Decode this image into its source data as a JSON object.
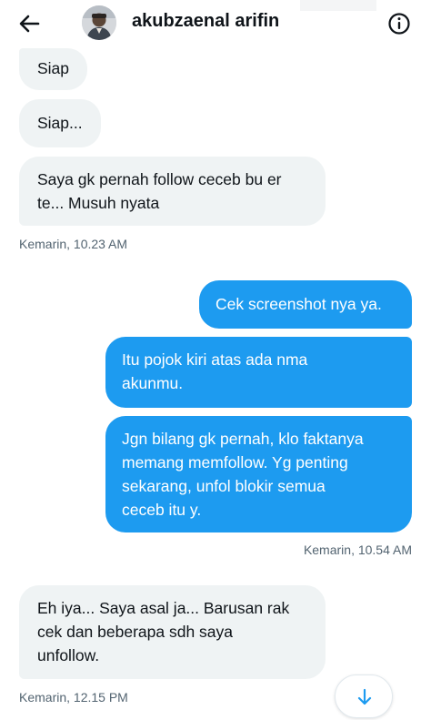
{
  "header": {
    "title": "akubzaenal arifin",
    "back_icon": "arrow-left-icon",
    "info_icon": "info-circle-icon"
  },
  "messages": [
    {
      "direction": "incoming",
      "text": "Siap"
    },
    {
      "direction": "incoming",
      "text": "Siap..."
    },
    {
      "direction": "incoming",
      "text": "Saya gk pernah follow ceceb bu er\nte... Musuh nyata"
    },
    {
      "direction": "outgoing",
      "text": "Cek screenshot nya ya."
    },
    {
      "direction": "outgoing",
      "text": "Itu pojok kiri atas ada nma\nakunmu."
    },
    {
      "direction": "outgoing",
      "text": "Jgn bilang gk pernah, klo faktanya\nmemang memfollow. Yg penting\nsekarang, unfol blokir semua\nceceb itu y."
    },
    {
      "direction": "incoming",
      "text": "Eh iya... Saya asal ja... Barusan rak\ncek dan beberapa sdh saya\nunfollow."
    }
  ],
  "timestamps": [
    "Kemarin, 10.23 AM",
    "Kemarin, 10.54 AM",
    "Kemarin, 12.15 PM"
  ],
  "colors": {
    "incoming_bubble": "#eff3f4",
    "outgoing_bubble": "#1d9bf0",
    "timestamp_text": "#536471",
    "scroll_arrow": "#1d9bf0"
  },
  "scroll_button_icon": "arrow-down-icon"
}
